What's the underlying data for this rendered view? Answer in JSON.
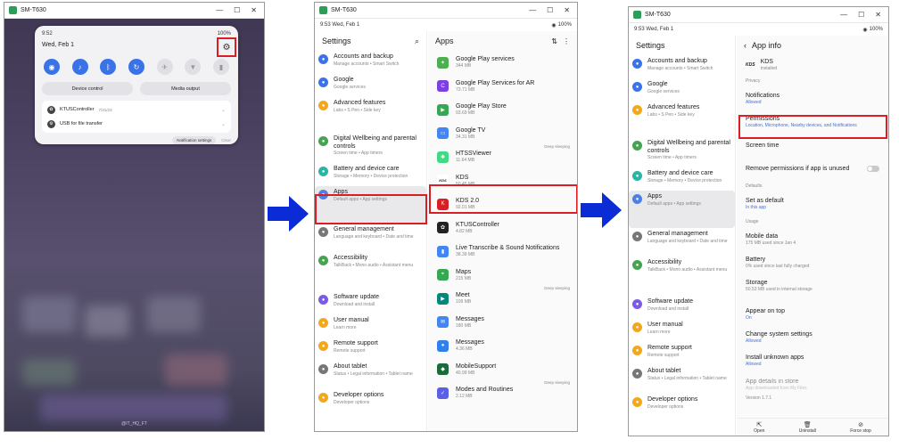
{
  "panel1": {
    "window_title": "SM-T630",
    "time": "9:52",
    "battery": "100%",
    "date": "Wed, Feb 1",
    "buttons": {
      "device_control": "Device control",
      "media_output": "Media output"
    },
    "notifications": [
      {
        "title": "KTUSController",
        "time": "7/31/23"
      },
      {
        "title": "USB for file transfer",
        "time": ""
      }
    ],
    "footer": {
      "settings": "Notification settings",
      "clear": "Clear"
    },
    "watermark": "@IT_HQ_FT"
  },
  "panel2": {
    "window_title": "SM-T630",
    "status": "9:53  Wed, Feb 1",
    "battery": "100%",
    "settings_title": "Settings",
    "apps_title": "Apps",
    "settings_items": [
      {
        "title": "Accounts and backup",
        "sub": "Manage accounts • Smart Switch",
        "color": "#3a73e8"
      },
      {
        "title": "Google",
        "sub": "Google services",
        "color": "#3a73e8"
      },
      {
        "title": "Advanced features",
        "sub": "Labs • S Pen • Side key",
        "color": "#f2a81d"
      },
      {
        "title": "Digital Wellbeing and parental controls",
        "sub": "Screen time • App timers",
        "color": "#46a352"
      },
      {
        "title": "Battery and device care",
        "sub": "Storage • Memory • Device protection",
        "color": "#2ab5a5"
      },
      {
        "title": "Apps",
        "sub": "Default apps • App settings",
        "color": "#4f7fe6"
      },
      {
        "title": "General management",
        "sub": "Language and keyboard • Date and time",
        "color": "#777"
      },
      {
        "title": "Accessibility",
        "sub": "TalkBack • Mono audio • Assistant menu",
        "color": "#46a352"
      },
      {
        "title": "Software update",
        "sub": "Download and install",
        "color": "#7b5be6"
      },
      {
        "title": "User manual",
        "sub": "Learn more",
        "color": "#f2a81d"
      },
      {
        "title": "Remote support",
        "sub": "Remote support",
        "color": "#f2a81d"
      },
      {
        "title": "About tablet",
        "sub": "Status • Legal information • Tablet name",
        "color": "#777"
      },
      {
        "title": "Developer options",
        "sub": "Developer options",
        "color": "#f2a81d"
      }
    ],
    "apps": [
      {
        "name": "Google Play services",
        "size": "344 MB",
        "tag": "",
        "color": "#4caf50",
        "glyph": "✦"
      },
      {
        "name": "Google Play Services for AR",
        "size": "73.71 MB",
        "tag": "",
        "color": "#7b3fe4",
        "glyph": "C"
      },
      {
        "name": "Google Play Store",
        "size": "93.69 MB",
        "tag": "",
        "color": "#34a853",
        "glyph": "▶"
      },
      {
        "name": "Google TV",
        "size": "34.31 MB",
        "tag": "Deep sleeping",
        "color": "#4285f4",
        "glyph": "▭"
      },
      {
        "name": "HTSSViewer",
        "size": "11.64 MB",
        "tag": "",
        "color": "#3ddc84",
        "glyph": "✱"
      },
      {
        "name": "KDS",
        "size": "50.45 MB",
        "tag": "",
        "color": "#ffffff",
        "glyph": "KDS"
      },
      {
        "name": "KDS 2.0",
        "size": "92.01 MB",
        "tag": "",
        "color": "#d81f26",
        "glyph": "K"
      },
      {
        "name": "KTUSController",
        "size": "4.82 MB",
        "tag": "",
        "color": "#222",
        "glyph": "✿"
      },
      {
        "name": "Live Transcribe & Sound Notifications",
        "size": "38.39 MB",
        "tag": "",
        "color": "#4285f4",
        "glyph": "▮"
      },
      {
        "name": "Maps",
        "size": "215 MB",
        "tag": "Deep sleeping",
        "color": "#34a853",
        "glyph": "⌖"
      },
      {
        "name": "Meet",
        "size": "109 MB",
        "tag": "",
        "color": "#00897b",
        "glyph": "▶"
      },
      {
        "name": "Messages",
        "size": "180 MB",
        "tag": "",
        "color": "#4285f4",
        "glyph": "✉"
      },
      {
        "name": "Messages",
        "size": "4.36 MB",
        "tag": "",
        "color": "#2f80ed",
        "glyph": "●"
      },
      {
        "name": "MobileSupport",
        "size": "40.99 MB",
        "tag": "Deep sleeping",
        "color": "#1a6b3a",
        "glyph": "◆"
      },
      {
        "name": "Modes and Routines",
        "size": "2.12 MB",
        "tag": "",
        "color": "#5b5fe6",
        "glyph": "✓"
      }
    ]
  },
  "panel3": {
    "window_title": "SM-T630",
    "status": "9:53  Wed, Feb 1",
    "battery": "100%",
    "settings_title": "Settings",
    "app_info_title": "App info",
    "app_name": "KDS",
    "app_status": "Installed",
    "sections": [
      {
        "header": "Privacy",
        "options": [
          {
            "title": "Notifications",
            "sub": "Allowed",
            "blue": true
          },
          {
            "title": "Permissions",
            "sub": "Location, Microphone, Nearby devices, and Notifications",
            "blue": true
          },
          {
            "title": "Screen time",
            "sub": "",
            "blue": false
          },
          {
            "title": "Remove permissions if app is unused",
            "sub": "",
            "blue": false
          }
        ]
      },
      {
        "header": "Defaults",
        "options": [
          {
            "title": "Set as default",
            "sub": "In this app",
            "blue": true
          }
        ]
      },
      {
        "header": "Usage",
        "options": [
          {
            "title": "Mobile data",
            "sub": "175 MB used since Jan 4",
            "blue": false
          },
          {
            "title": "Battery",
            "sub": "0% used since last fully charged",
            "blue": false
          },
          {
            "title": "Storage",
            "sub": "50.53 MB used in internal storage",
            "blue": false
          }
        ]
      },
      {
        "header": "",
        "options": [
          {
            "title": "Appear on top",
            "sub": "On",
            "blue": true
          },
          {
            "title": "Change system settings",
            "sub": "Allowed",
            "blue": true
          },
          {
            "title": "Install unknown apps",
            "sub": "Allowed",
            "blue": true
          }
        ]
      }
    ],
    "app_details": {
      "title": "App details in store",
      "sub": "App downloaded from My Files"
    },
    "version": "Version 1.7.1",
    "bottom": {
      "open": "Open",
      "uninstall": "Uninstall",
      "force_stop": "Force stop"
    }
  }
}
